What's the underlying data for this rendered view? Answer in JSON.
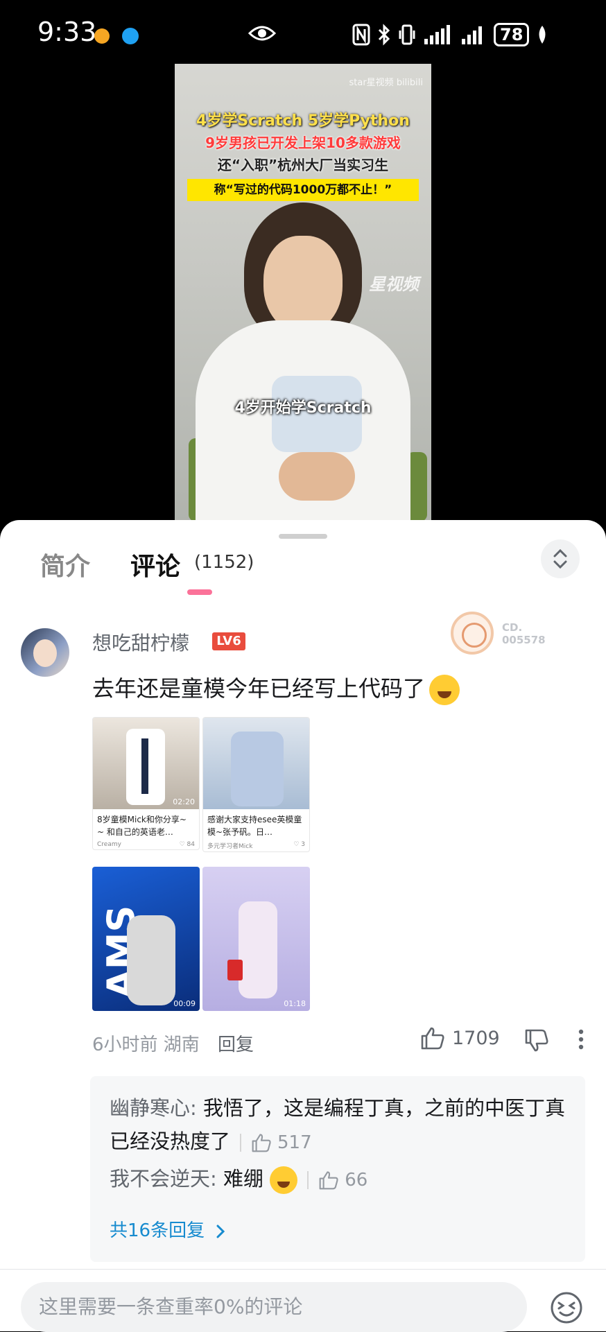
{
  "status_bar": {
    "time": "9:33",
    "battery": "78"
  },
  "video": {
    "watermark": "star星视频 bilibili",
    "line1": "4岁学Scratch 5岁学Python",
    "line2": "9岁男孩已开发上架10多款游戏",
    "line3": "还“入职”杭州大厂当实习生",
    "line4": "称“写过的代码1000万都不止！”",
    "logo": "星视频",
    "subtitle": "4岁开始学Scratch"
  },
  "tabs": {
    "intro": "简介",
    "comments": "评论",
    "comment_count": "(1152)"
  },
  "comment": {
    "username": "想吃甜柠檬",
    "level": "LV6",
    "fan_badge_text": "CD.\n005578",
    "text": "去年还是童模今年已经写上代码了",
    "time_location": "6小时前 湖南",
    "reply_label": "回复",
    "likes": "1709",
    "cards": [
      {
        "title": "8岁童模Mick和你分享~ ~ 和自己的英语老…",
        "author": "Creamy",
        "likes": "84",
        "duration": "02:20"
      },
      {
        "title": "感谢大家支持esee英模童模~张予矾。日…",
        "author": "多元学习者Mick",
        "likes": "3"
      },
      {
        "duration": "00:09"
      },
      {
        "duration": "01:18"
      }
    ]
  },
  "replies": [
    {
      "user": "幽静寒心:",
      "text": "我悟了，这是编程丁真，之前的中医丁真已经没热度了",
      "likes": "517"
    },
    {
      "user": "我不会逆天:",
      "text": "难绷",
      "likes": "66"
    }
  ],
  "reply_more": "共16条回复",
  "input": {
    "placeholder": "这里需要一条查重率0%的评论"
  },
  "colors": {
    "accent_pink": "#fb7299",
    "link_blue": "#178bcf",
    "level_red": "#e94c3d"
  }
}
